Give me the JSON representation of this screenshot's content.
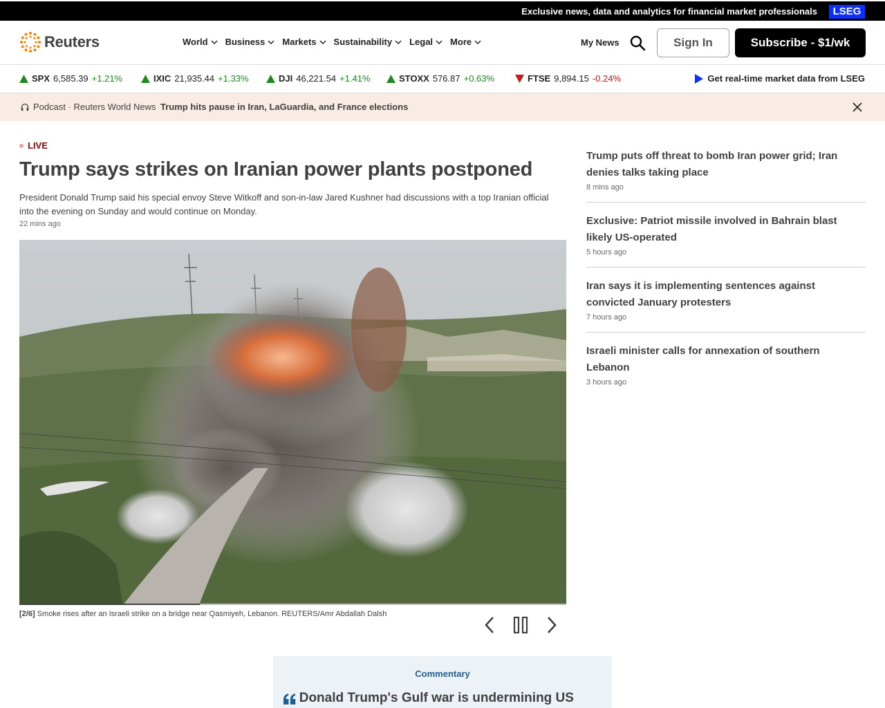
{
  "promo": {
    "text": "Exclusive news, data and analytics for financial market professionals",
    "badge": "LSEG"
  },
  "header": {
    "logo_text": "Reuters",
    "nav": [
      {
        "label": "World"
      },
      {
        "label": "Business"
      },
      {
        "label": "Markets"
      },
      {
        "label": "Sustainability"
      },
      {
        "label": "Legal"
      },
      {
        "label": "More"
      }
    ],
    "my_news": "My News",
    "sign_in": "Sign In",
    "subscribe": "Subscribe - $1/wk",
    "brand_color": "#ff8000"
  },
  "ticker": {
    "items": [
      {
        "symbol": "SPX",
        "value": "6,585.39",
        "change": "+1.21%",
        "direction": "up"
      },
      {
        "symbol": "IXIC",
        "value": "21,935.44",
        "change": "+1.33%",
        "direction": "up"
      },
      {
        "symbol": "DJI",
        "value": "46,221.54",
        "change": "+1.41%",
        "direction": "up"
      },
      {
        "symbol": "STOXX",
        "value": "576.87",
        "change": "+0.63%",
        "direction": "up"
      },
      {
        "symbol": "FTSE",
        "value": "9,894.15",
        "change": "-0.24%",
        "direction": "down"
      }
    ],
    "realtime_link": "Get real-time market data from LSEG",
    "up_color": "#1f8a1f",
    "down_color": "#c41a1a"
  },
  "podcast": {
    "label": "Podcast · Reuters World News",
    "title": "Trump hits pause in Iran, LaGuardia, and France elections"
  },
  "lead": {
    "live_label": "LIVE",
    "headline": "Trump says strikes on Iranian power plants postponed",
    "summary": "President Donald Trump said his special envoy Steve Witkoff and son-in-law Jared Kushner had discussions with a top Iranian official into the evening on Sunday and would continue on Monday.",
    "time": "22 mins ago",
    "caption_index": "[2/6]",
    "caption": "Smoke rises after an Israeli strike on a bridge near Qasmiyeh, Lebanon. REUTERS/Amr Abdallah Dalsh",
    "gallery_progress": 0.33
  },
  "sidebar": {
    "stories": [
      {
        "title": "Trump puts off threat to bomb Iran power grid; Iran denies talks taking place",
        "time": "8 mins ago"
      },
      {
        "title": "Exclusive: Patriot missile involved in Bahrain blast likely US-operated",
        "time": "5 hours ago"
      },
      {
        "title": "Iran says it is implementing sentences against convicted January protesters",
        "time": "7 hours ago"
      },
      {
        "title": "Israeli minister calls for annexation of southern Lebanon",
        "time": "3 hours ago"
      }
    ]
  },
  "commentary": {
    "label": "Commentary",
    "title": "Donald Trump's Gulf war is undermining US power"
  }
}
